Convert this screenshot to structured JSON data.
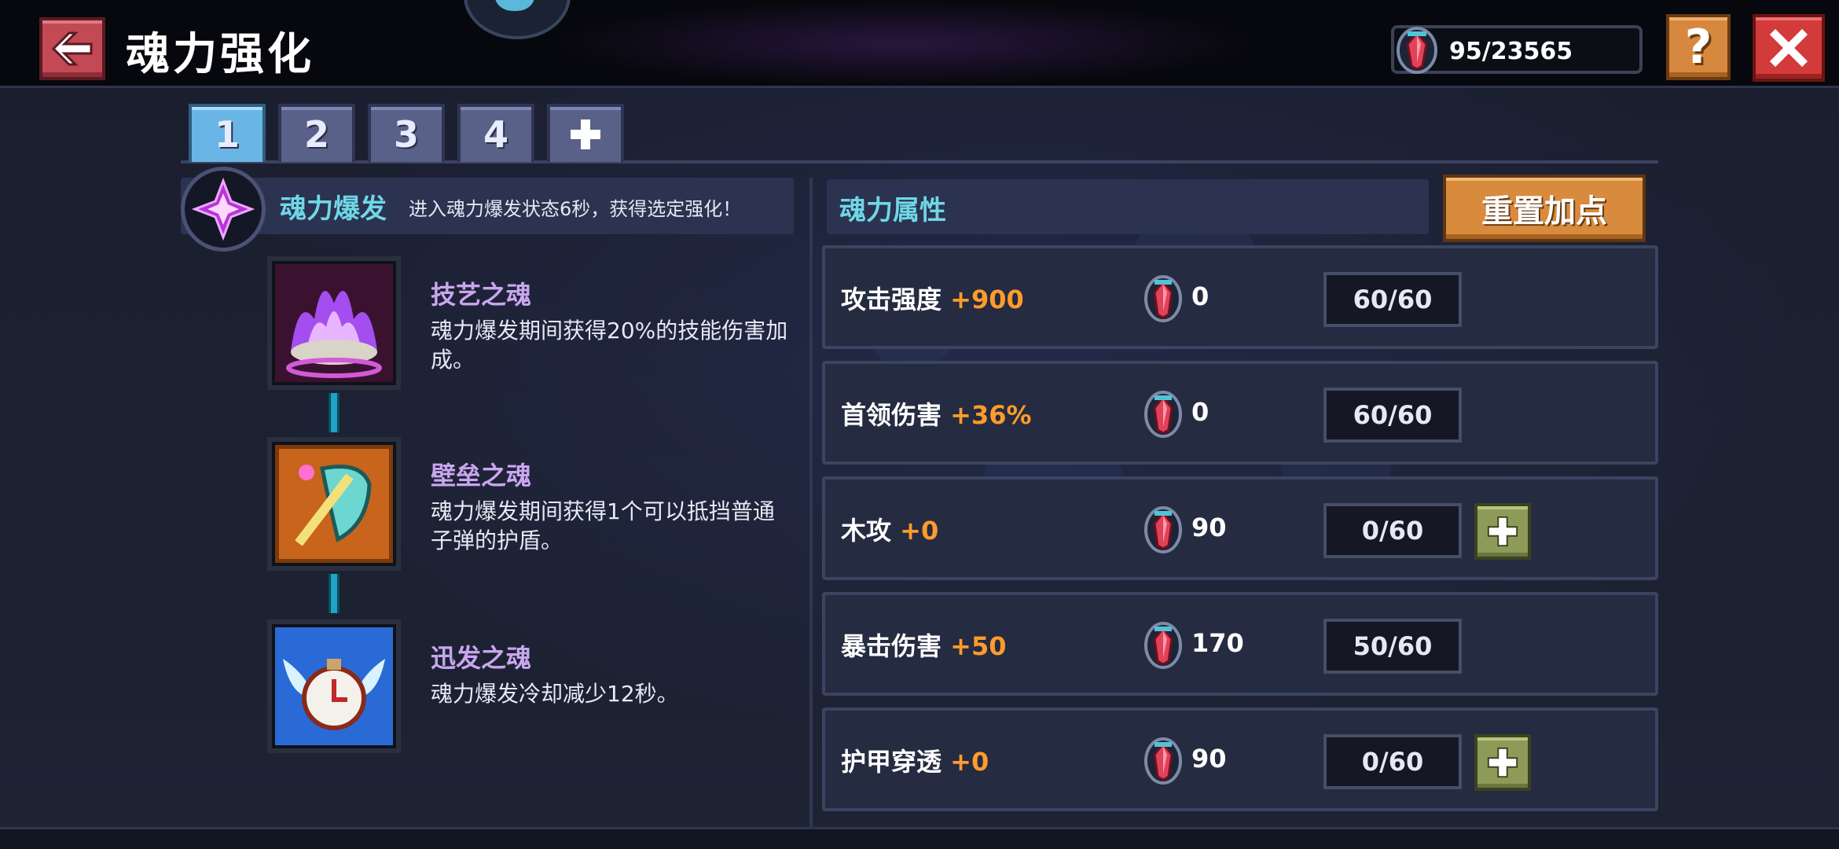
{
  "header": {
    "title": "魂力强化",
    "currency": "95/23565"
  },
  "tabs": [
    {
      "label": "1",
      "active": true
    },
    {
      "label": "2"
    },
    {
      "label": "3"
    },
    {
      "label": "4"
    }
  ],
  "burst": {
    "title": "魂力爆发",
    "description": "进入魂力爆发状态6秒，获得选定强化！"
  },
  "skills": [
    {
      "name": "技艺之魂",
      "description": "魂力爆发期间获得20%的技能伤害加成。",
      "icon": "purple-flame-icon"
    },
    {
      "name": "壁垒之魂",
      "description": "魂力爆发期间获得1个可以抵挡普通子弹的护盾。",
      "icon": "shield-sword-icon"
    },
    {
      "name": "迅发之魂",
      "description": "魂力爆发冷却减少12秒。",
      "icon": "winged-clock-icon"
    }
  ],
  "attributes": {
    "title": "魂力属性",
    "reset_label": "重置加点",
    "rows": [
      {
        "name": "攻击强度",
        "bonus": "+900",
        "cost": "0",
        "level": "60/60",
        "level_value": 60,
        "level_max": 60,
        "can_add": false
      },
      {
        "name": "首领伤害",
        "bonus": "+36%",
        "cost": "0",
        "level": "60/60",
        "level_value": 60,
        "level_max": 60,
        "can_add": false
      },
      {
        "name": "木攻",
        "bonus": "+0",
        "cost": "90",
        "level": "0/60",
        "level_value": 0,
        "level_max": 60,
        "can_add": true
      },
      {
        "name": "暴击伤害",
        "bonus": "+50",
        "cost": "170",
        "level": "50/60",
        "level_value": 50,
        "level_max": 60,
        "can_add": false
      },
      {
        "name": "护甲穿透",
        "bonus": "+0",
        "cost": "90",
        "level": "0/60",
        "level_value": 0,
        "level_max": 60,
        "can_add": true
      }
    ]
  },
  "colors": {
    "accent_cyan": "#6fd7e6",
    "bonus_orange": "#ff9b2c",
    "skill_name_purple": "#c9a6ef",
    "active_tab": "#69b6e6"
  }
}
